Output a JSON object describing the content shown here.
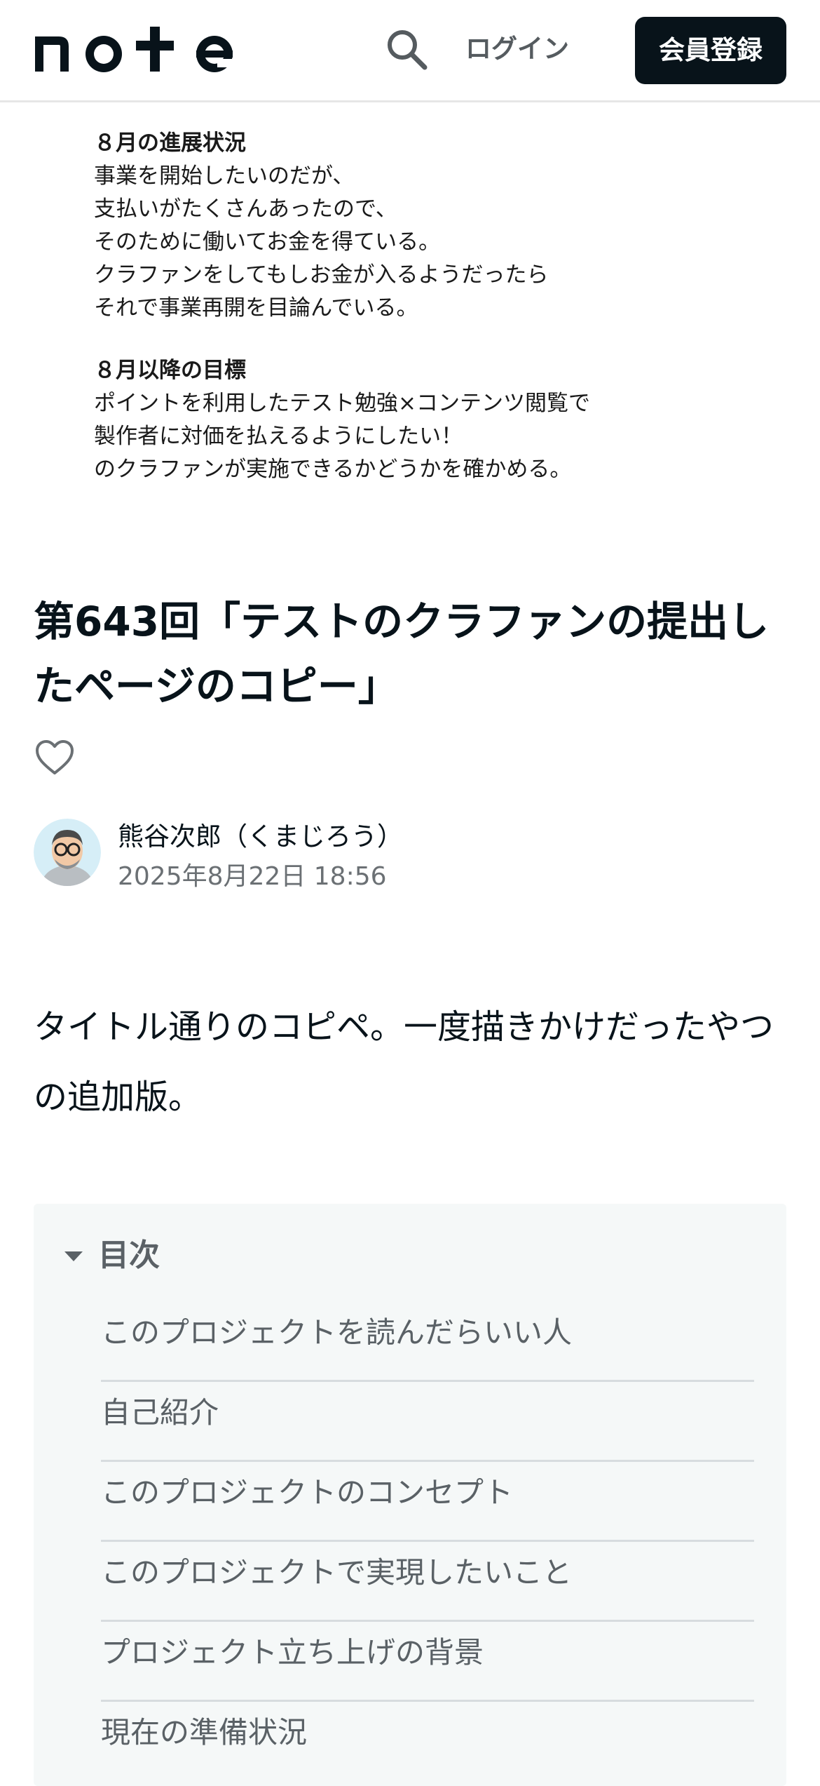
{
  "header": {
    "logo_text": "note",
    "search_icon": "search-icon",
    "login_label": "ログイン",
    "signup_label": "会員登録"
  },
  "eyecatch": {
    "progress_heading": "８月の進展状況",
    "progress_lines": [
      "事業を開始したいのだが、",
      "支払いがたくさんあったので、",
      "そのために働いてお金を得ている。",
      "クラファンをしてもしお金が入るようだったら",
      "それで事業再開を目論んでいる。"
    ],
    "goal_heading": "８月以降の目標",
    "goal_lines": [
      "ポイントを利用したテスト勉強×コンテンツ閲覧で",
      "製作者に対価を払えるようにしたい！",
      "のクラファンが実施できるかどうかを確かめる。"
    ]
  },
  "article": {
    "title_line1": "第643回「テストのクラファンの提出し",
    "title_line2": "たページのコピー」",
    "like_icon": "heart-icon",
    "author_name": "熊谷次郎（くまじろう）",
    "post_date": "2025年8月22日 18:56",
    "body_line1": "タイトル通りのコピペ。一度描きかけだったやつ",
    "body_line2": "の追加版。"
  },
  "toc": {
    "title": "目次",
    "items": [
      "このプロジェクトを読んだらいい人",
      "自己紹介",
      "このプロジェクトのコンセプト",
      "このプロジェクトで実現したいこと",
      "プロジェクト立ち上げの背景",
      "現在の準備状況"
    ]
  }
}
